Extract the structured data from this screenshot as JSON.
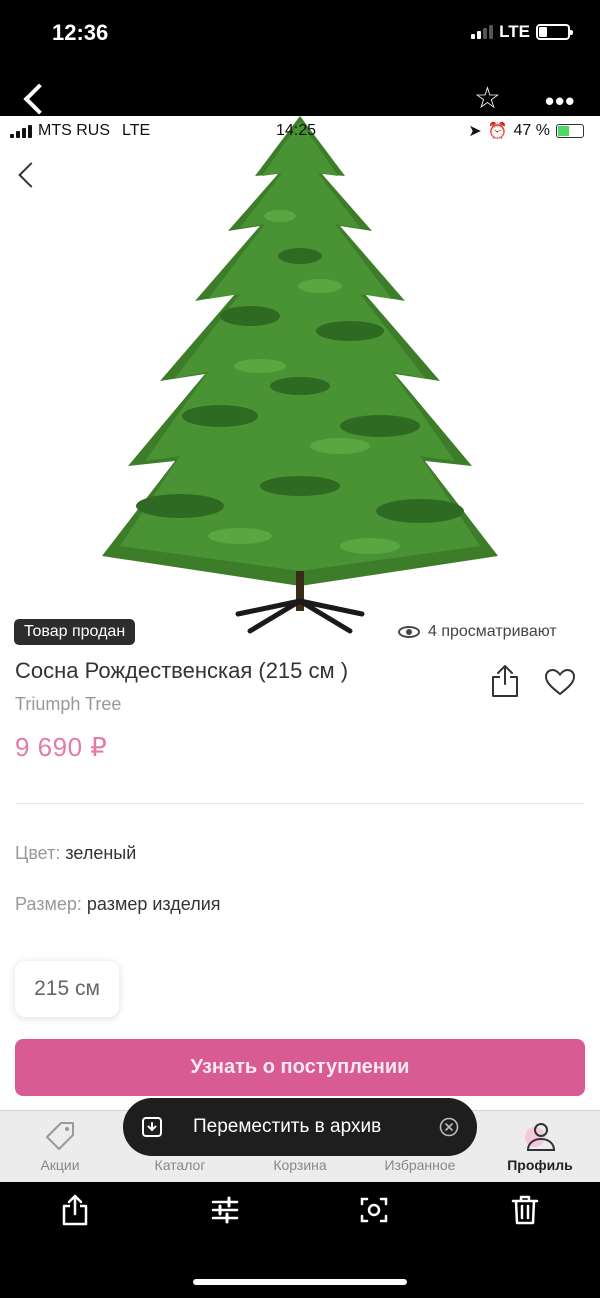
{
  "outer_status": {
    "time": "12:36",
    "network": "LTE"
  },
  "inner_status": {
    "carrier": "MTS RUS",
    "network": "LTE",
    "time": "14:25",
    "battery": "47 %"
  },
  "product": {
    "badge": "Товар продан",
    "viewers": "4 просматривают",
    "title": "Сосна Рождественская (215 см )",
    "brand": "Triumph Tree",
    "price": "9 690 ₽",
    "color_label": "Цвет:",
    "color_value": "зеленый",
    "size_label": "Размер:",
    "size_value": "размер изделия",
    "size_option": "215 см",
    "notify_button": "Узнать о поступлении"
  },
  "toast": {
    "label": "Переместить в архив"
  },
  "tabs": [
    {
      "label": "Акции",
      "icon": "tag-icon"
    },
    {
      "label": "Каталог",
      "icon": "catalog-icon"
    },
    {
      "label": "Корзина",
      "icon": "cart-icon"
    },
    {
      "label": "Избранное",
      "icon": "heart-icon"
    },
    {
      "label": "Профиль",
      "icon": "profile-icon",
      "active": true
    }
  ],
  "colors": {
    "accent": "#d85b93",
    "price": "#e27ba7",
    "tree": "#3f8a2c"
  }
}
